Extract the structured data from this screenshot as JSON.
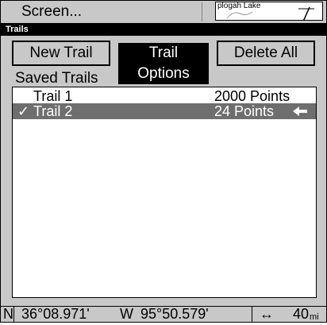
{
  "topbar": {
    "screen_label": "Screen...",
    "map_label": "plogah Lake"
  },
  "title": "Trails",
  "buttons": {
    "new_trail": "New Trail",
    "trail_options": "Trail Options",
    "delete_all": "Delete All"
  },
  "saved_trails": {
    "label": "Saved Trails",
    "items": [
      {
        "name": "Trail 1",
        "points": "2000 Points",
        "checked": false,
        "selected": false
      },
      {
        "name": "Trail 2",
        "points": "24 Points",
        "checked": true,
        "selected": true,
        "check_glyph": "✓"
      }
    ]
  },
  "status": {
    "lat_hem": "N",
    "lat": "36°08.971'",
    "lon_hem": "W",
    "lon": "95°50.579'",
    "distance_icon": "↔",
    "distance_value": "40",
    "distance_unit": "mi"
  },
  "colors": {
    "background": "#c8c8c8",
    "title_bar": "#000000",
    "selected_row": "#6e6e6e"
  }
}
